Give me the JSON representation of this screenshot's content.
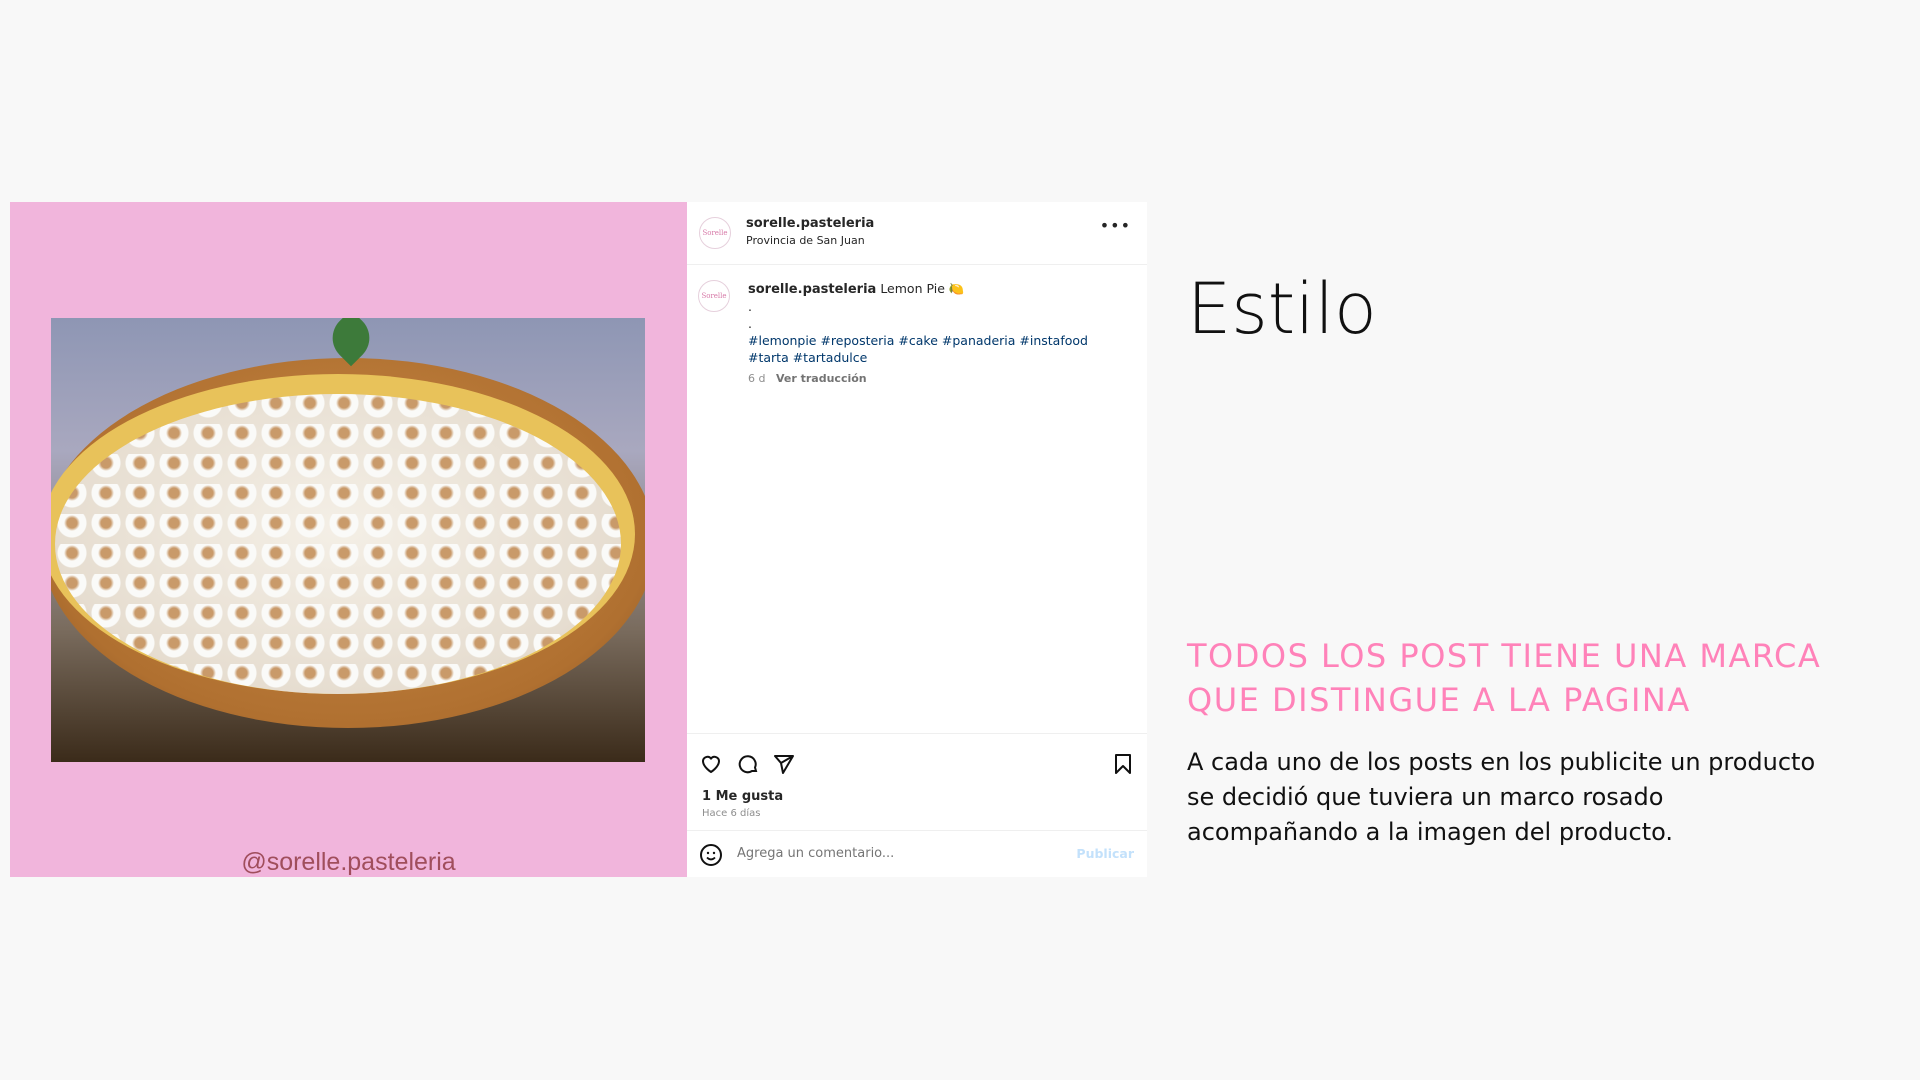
{
  "slide": {
    "title": "Estilo",
    "heading": "TODOS LOS POST TIENE UNA MARCA QUE DISTINGUE A LA PAGINA",
    "body": "A cada uno de los posts en los publicite un producto se decidió que tuviera un marco rosado acompañando a la imagen del producto.",
    "accent_color": "#ff82b9"
  },
  "image": {
    "watermark": "@sorelle.pasteleria",
    "frame_color": "#f1b5dc",
    "avatar_logo": "Sorelle"
  },
  "post": {
    "username": "sorelle.pasteleria",
    "location": "Provincia de San Juan",
    "more_icon": "more-horizontal-icon",
    "caption": {
      "username": "sorelle.pasteleria",
      "text": "Lemon Pie",
      "emoji": "🍋",
      "dots": [
        ".",
        "."
      ],
      "hashtags": "#lemonpie #reposteria #cake #panaderia #instafood #tarta #tartadulce",
      "age": "6 d",
      "translate": "Ver traducción"
    },
    "likes": "1 Me gusta",
    "posted": "Hace 6 días",
    "comment_placeholder": "Agrega un comentario...",
    "publish": "Publicar"
  }
}
